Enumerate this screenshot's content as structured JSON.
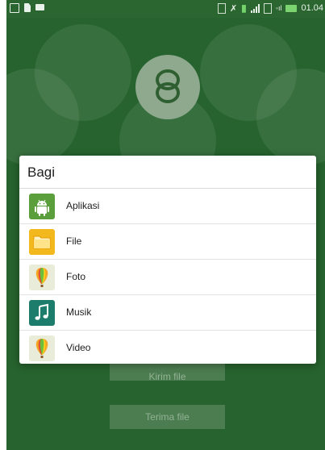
{
  "status_bar": {
    "time": "01.04"
  },
  "background": {
    "send_button_label": "Kirim file",
    "receive_button_label": "Terima file"
  },
  "dialog": {
    "title": "Bagi",
    "items": [
      {
        "label": "Aplikasi",
        "icon": "android-icon"
      },
      {
        "label": "File",
        "icon": "folder-icon"
      },
      {
        "label": "Foto",
        "icon": "balloon-icon"
      },
      {
        "label": "Musik",
        "icon": "music-note-icon"
      },
      {
        "label": "Video",
        "icon": "balloon-icon"
      }
    ]
  },
  "colors": {
    "background_green": "#26632e",
    "dialog_background": "#ffffff",
    "accent_green": "#5a9f3c"
  }
}
